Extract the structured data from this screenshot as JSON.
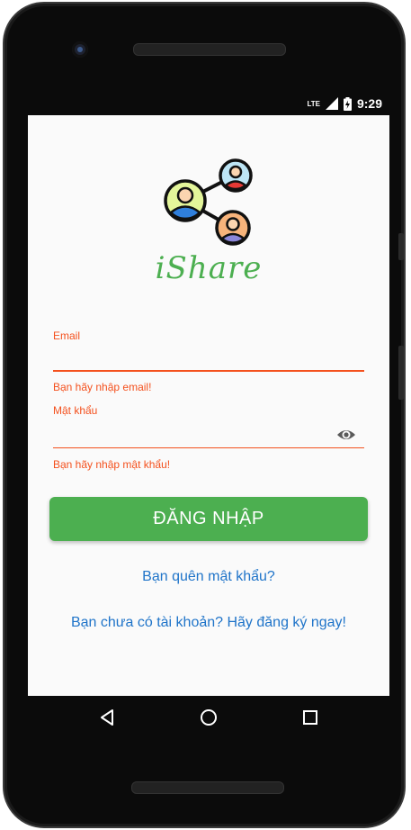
{
  "status_bar": {
    "network": "LTE",
    "time": "9:29"
  },
  "app": {
    "brand_name": "iShare",
    "logo": "share-network-people-icon"
  },
  "form": {
    "email": {
      "label": "Email",
      "value": "",
      "error": "Bạn hãy nhập email!"
    },
    "password": {
      "label": "Mật khẩu",
      "value": "",
      "error": "Bạn hãy nhập mật khẩu!",
      "toggle_icon": "eye-icon"
    },
    "login_button_label": "ĐĂNG NHẬP",
    "forgot_password_link": "Bạn quên mật khẩu?",
    "register_link": "Bạn chưa có tài khoản? Hãy đăng ký ngay!"
  },
  "navigation": {
    "back_icon": "back-triangle-icon",
    "home_icon": "home-circle-icon",
    "recents_icon": "recents-square-icon"
  },
  "colors": {
    "accent_green": "#4caf50",
    "error_orange": "#f4511e",
    "link_blue": "#1f74c9",
    "screen_bg": "#fafafa"
  }
}
